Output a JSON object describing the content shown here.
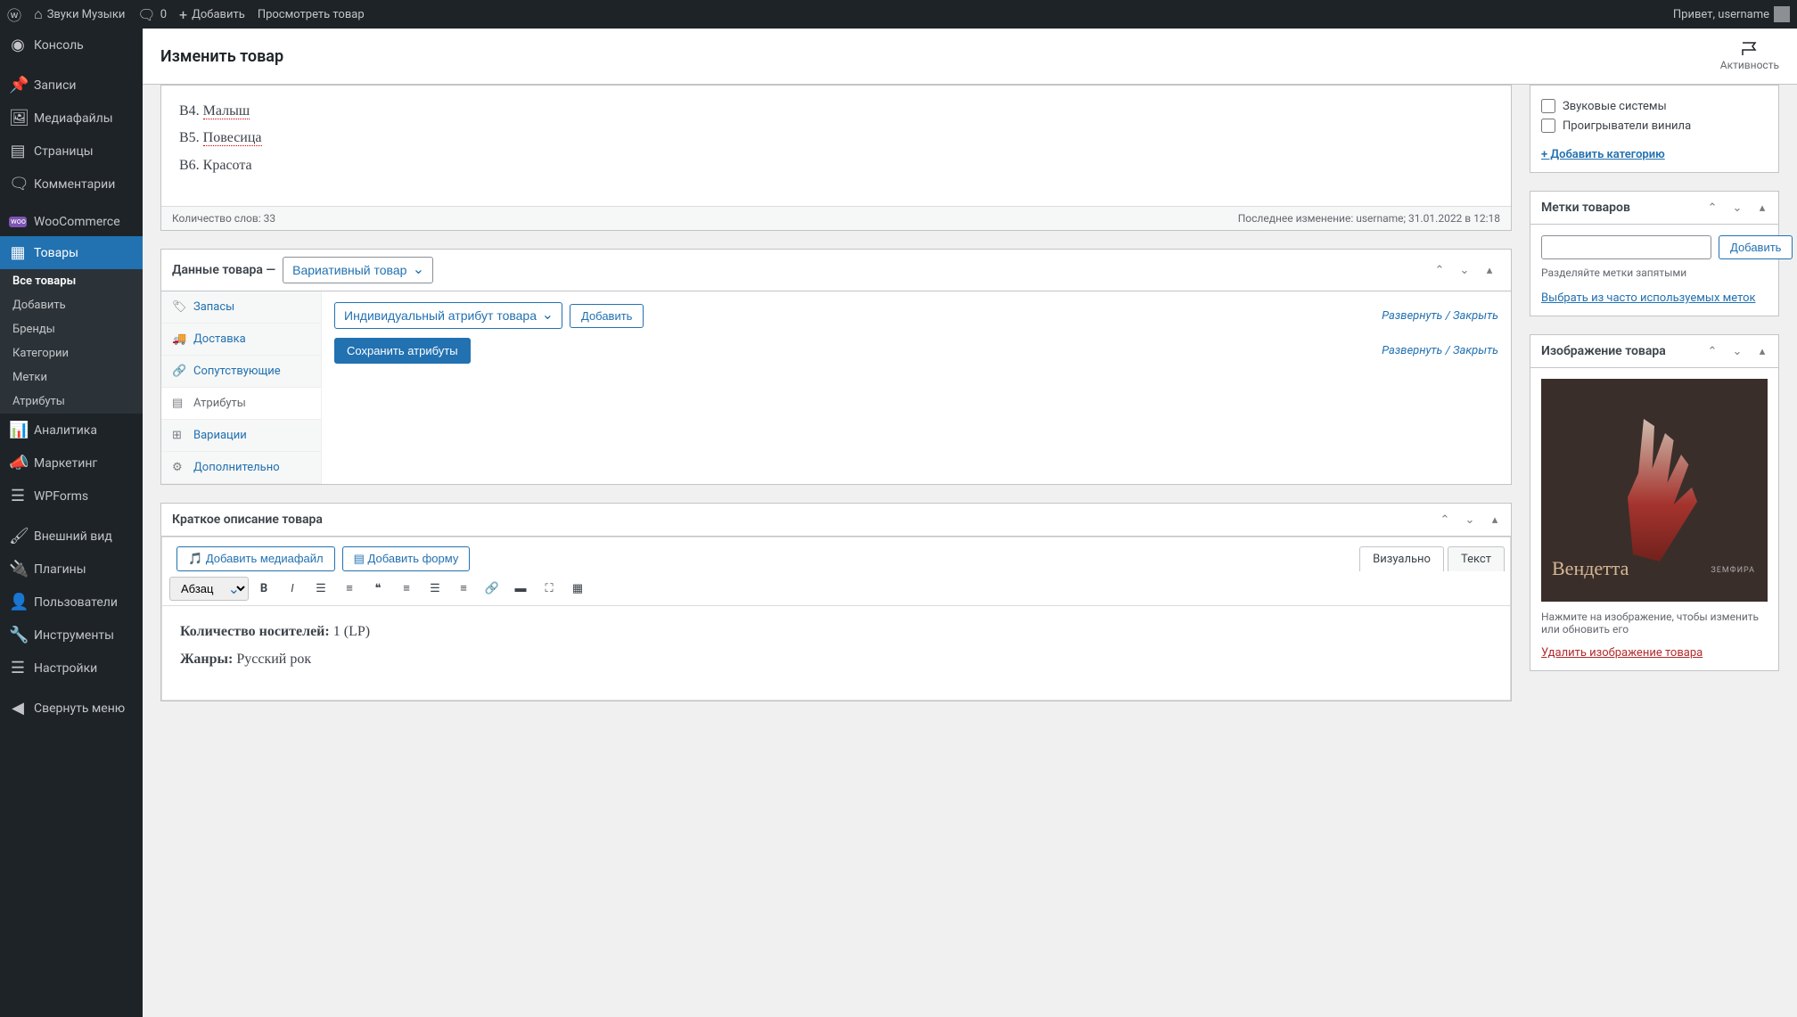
{
  "adminbar": {
    "site_name": "Звуки Музыки",
    "comments": "0",
    "add": "Добавить",
    "view_product": "Просмотреть товар",
    "greeting": "Привет, username"
  },
  "sidebar": {
    "dashboard": "Консоль",
    "posts": "Записи",
    "media": "Медиафайлы",
    "pages": "Страницы",
    "comments": "Комментарии",
    "woocommerce": "WooCommerce",
    "products": "Товары",
    "analytics": "Аналитика",
    "marketing": "Маркетинг",
    "wpforms": "WPForms",
    "appearance": "Внешний вид",
    "plugins": "Плагины",
    "users": "Пользователи",
    "tools": "Инструменты",
    "settings": "Настройки",
    "collapse": "Свернуть меню",
    "submenu": {
      "all": "Все товары",
      "add": "Добавить",
      "brands": "Бренды",
      "categories": "Категории",
      "tags": "Метки",
      "attributes": "Атрибуты"
    }
  },
  "header": {
    "title": "Изменить товар",
    "activity": "Активность"
  },
  "editor": {
    "lines": {
      "b4_prefix": "B4. ",
      "b4_text": "Малыш",
      "b5_prefix": "B5. ",
      "b5_text": "Повесица",
      "b6": "B6. Красота"
    },
    "word_count": "Количество слов: 33",
    "last_edit": "Последнее изменение: username; 31.01.2022 в 12:18"
  },
  "product_data": {
    "title": "Данные товара —",
    "type": "Вариативный товар",
    "tabs": {
      "inventory": "Запасы",
      "shipping": "Доставка",
      "linked": "Сопутствующие",
      "attributes": "Атрибуты",
      "variations": "Вариации",
      "advanced": "Дополнительно"
    },
    "attribute_select": "Индивидуальный атрибут товара",
    "add_btn": "Добавить",
    "save_btn": "Сохранить атрибуты",
    "expand_close": "Развернуть / Закрыть"
  },
  "short_desc": {
    "title": "Краткое описание товара",
    "add_media": "Добавить медиафайл",
    "add_form": "Добавить форму",
    "tab_visual": "Визуально",
    "tab_text": "Текст",
    "format": "Абзац",
    "content_label1": "Количество носителей:",
    "content_value1": " 1 (LP)",
    "content_label2": "Жанры:",
    "content_value2": " Русский рок"
  },
  "categories": {
    "sound_systems": "Звуковые системы",
    "vinyl_players": "Проигрыватели винила",
    "add_link": "+ Добавить категорию"
  },
  "tags": {
    "title": "Метки товаров",
    "add_btn": "Добавить",
    "hint": "Разделяйте метки запятыми",
    "choose_link": "Выбрать из часто используемых меток"
  },
  "image": {
    "title": "Изображение товара",
    "album_title": "Вендетта",
    "album_artist": "ЗЕМФИРА",
    "hint": "Нажмите на изображение, чтобы изменить или обновить его",
    "delete": "Удалить изображение товара"
  }
}
